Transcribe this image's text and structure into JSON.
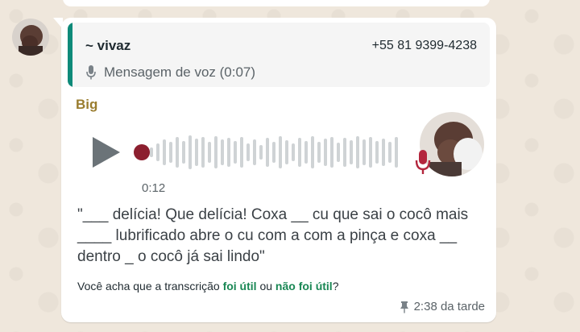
{
  "quoted": {
    "name": "~ vivaz",
    "phone": "+55 81 9399-4238",
    "preview": "Mensagem de voz (0:07)"
  },
  "message": {
    "sender": "Big",
    "duration": "0:12",
    "transcript": "\"___ delícia! Que delícia! Coxa __ cu que sai o cocô mais ____ lubrificado abre o cu com a com a pinça e coxa __ dentro _ o cocô já sai lindo\"",
    "feedback_prefix": "Você acha que a transcrição ",
    "feedback_useful": "foi útil",
    "feedback_or": " ou ",
    "feedback_not_useful": "não foi útil",
    "feedback_suffix": "?",
    "time": "2:38 da tarde"
  },
  "icons": {
    "play": "play-icon",
    "mic": "microphone-icon",
    "pin": "pin-icon"
  },
  "colors": {
    "quote_bar": "#0e8a79",
    "sender_name": "#9a7d2f",
    "link": "#198754",
    "scrub_dot": "#8c1f2f"
  }
}
